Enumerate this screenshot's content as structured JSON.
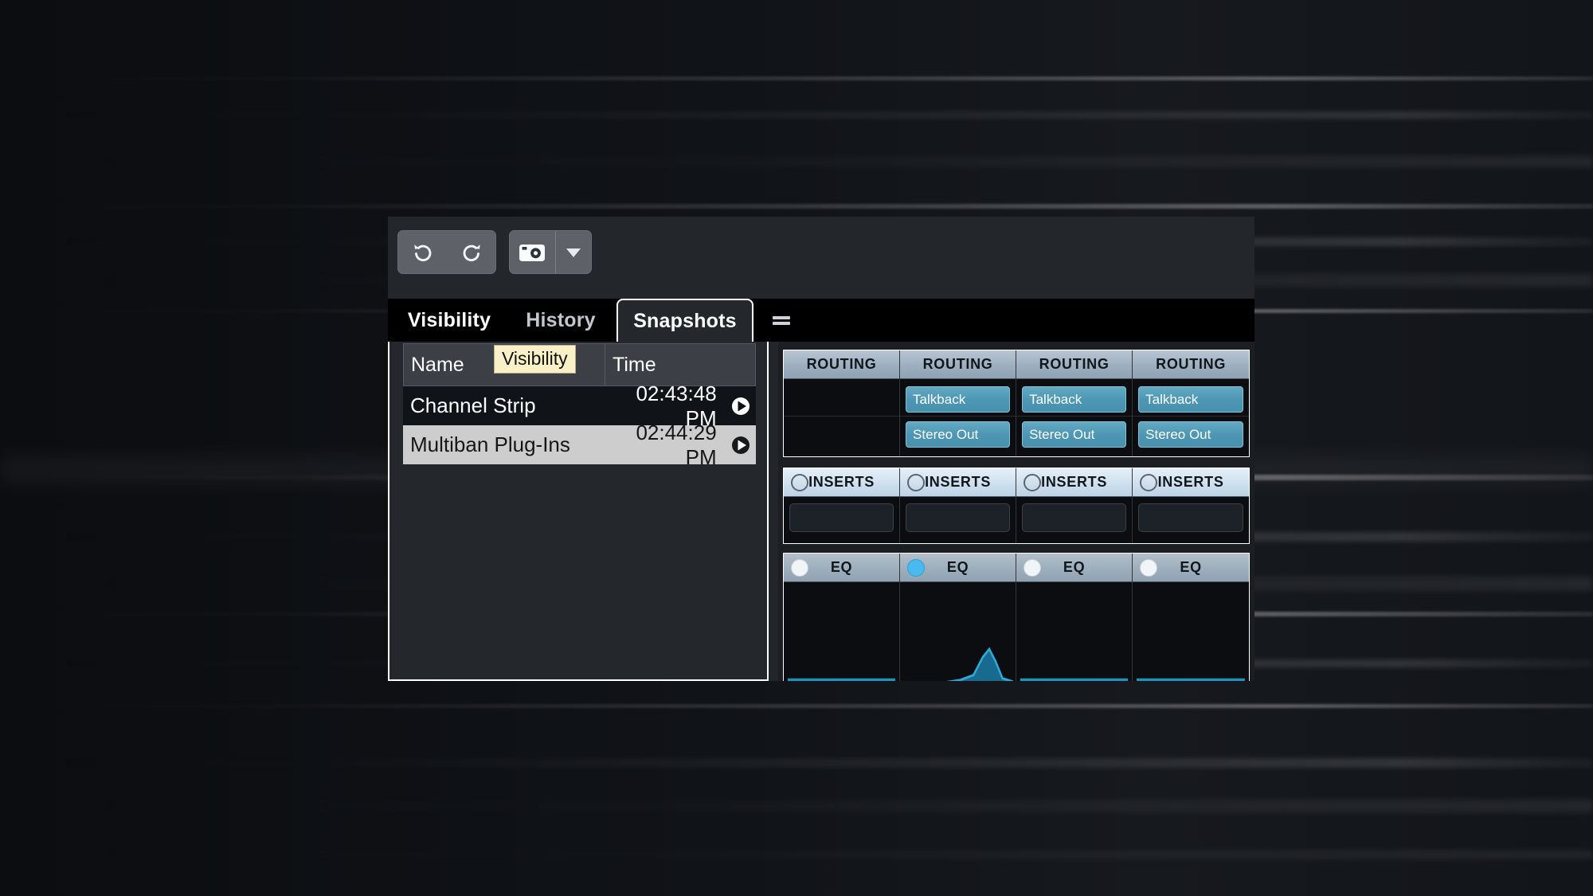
{
  "window": {
    "toolbar": {
      "undo_button_label": "Undo",
      "undo_icon": "undo-arrow-icon",
      "redo_button_label": "Redo",
      "redo_icon": "redo-arrow-icon",
      "snapshot_button_label": "Take Snapshot",
      "snapshot_icon": "camera-icon",
      "snapshot_menu_label": "Snapshot Options",
      "snapshot_menu_icon": "triangle-down-icon"
    },
    "tabs": [
      {
        "id": "visibility",
        "label": "Visibility",
        "active": false
      },
      {
        "id": "history",
        "label": "History",
        "active": false
      },
      {
        "id": "snapshots",
        "label": "Snapshots",
        "active": true
      }
    ],
    "tab_menu": {
      "label": "Panel Menu",
      "icon": "hamburger-menu-icon"
    },
    "tooltip": {
      "text": "Visibility",
      "background": "#faf0c8",
      "text_color": "#111111"
    }
  },
  "snapshots": {
    "columns": [
      "Name",
      "Time"
    ],
    "rows": [
      {
        "name": "Channel Strip",
        "time": "02:43:48 PM",
        "selected": false,
        "action_icon": "recall-play-icon"
      },
      {
        "name": "Multiban Plug-Ins",
        "time": "02:44:29 PM",
        "selected": true,
        "action_icon": "recall-play-icon"
      }
    ]
  },
  "mixer": {
    "sections": [
      {
        "id": "routing",
        "channels": [
          {
            "header": "ROUTING",
            "toggle": "none",
            "slots": []
          },
          {
            "header": "ROUTING",
            "toggle": "none",
            "slots": [
              "Talkback",
              "Stereo Out"
            ]
          },
          {
            "header": "ROUTING",
            "toggle": "none",
            "slots": [
              "Talkback",
              "Stereo Out"
            ]
          },
          {
            "header": "ROUTING",
            "toggle": "none",
            "slots": [
              "Talkback",
              "Stereo Out"
            ]
          }
        ]
      },
      {
        "id": "inserts",
        "channels": [
          {
            "header": "INSERTS",
            "toggle": "hollow"
          },
          {
            "header": "INSERTS",
            "toggle": "hollow"
          },
          {
            "header": "INSERTS",
            "toggle": "hollow"
          },
          {
            "header": "INSERTS",
            "toggle": "hollow"
          }
        ]
      },
      {
        "id": "eq",
        "channels": [
          {
            "header": "EQ",
            "toggle": "white",
            "curve": "flat"
          },
          {
            "header": "EQ",
            "toggle": "cyan",
            "curve": "peak"
          },
          {
            "header": "EQ",
            "toggle": "white",
            "curve": "flat"
          },
          {
            "header": "EQ",
            "toggle": "white",
            "curve": "flat"
          }
        ]
      }
    ]
  },
  "colors": {
    "accent_cyan": "#49b9ef",
    "eq_curve": "#1f93bf",
    "routing_slot": "#4e97b4",
    "selected_row": "#cdcdcd",
    "tooltip_bg": "#faf0c8",
    "panel_bg": "#24282d",
    "desktop_bg": "#0d0f12"
  }
}
